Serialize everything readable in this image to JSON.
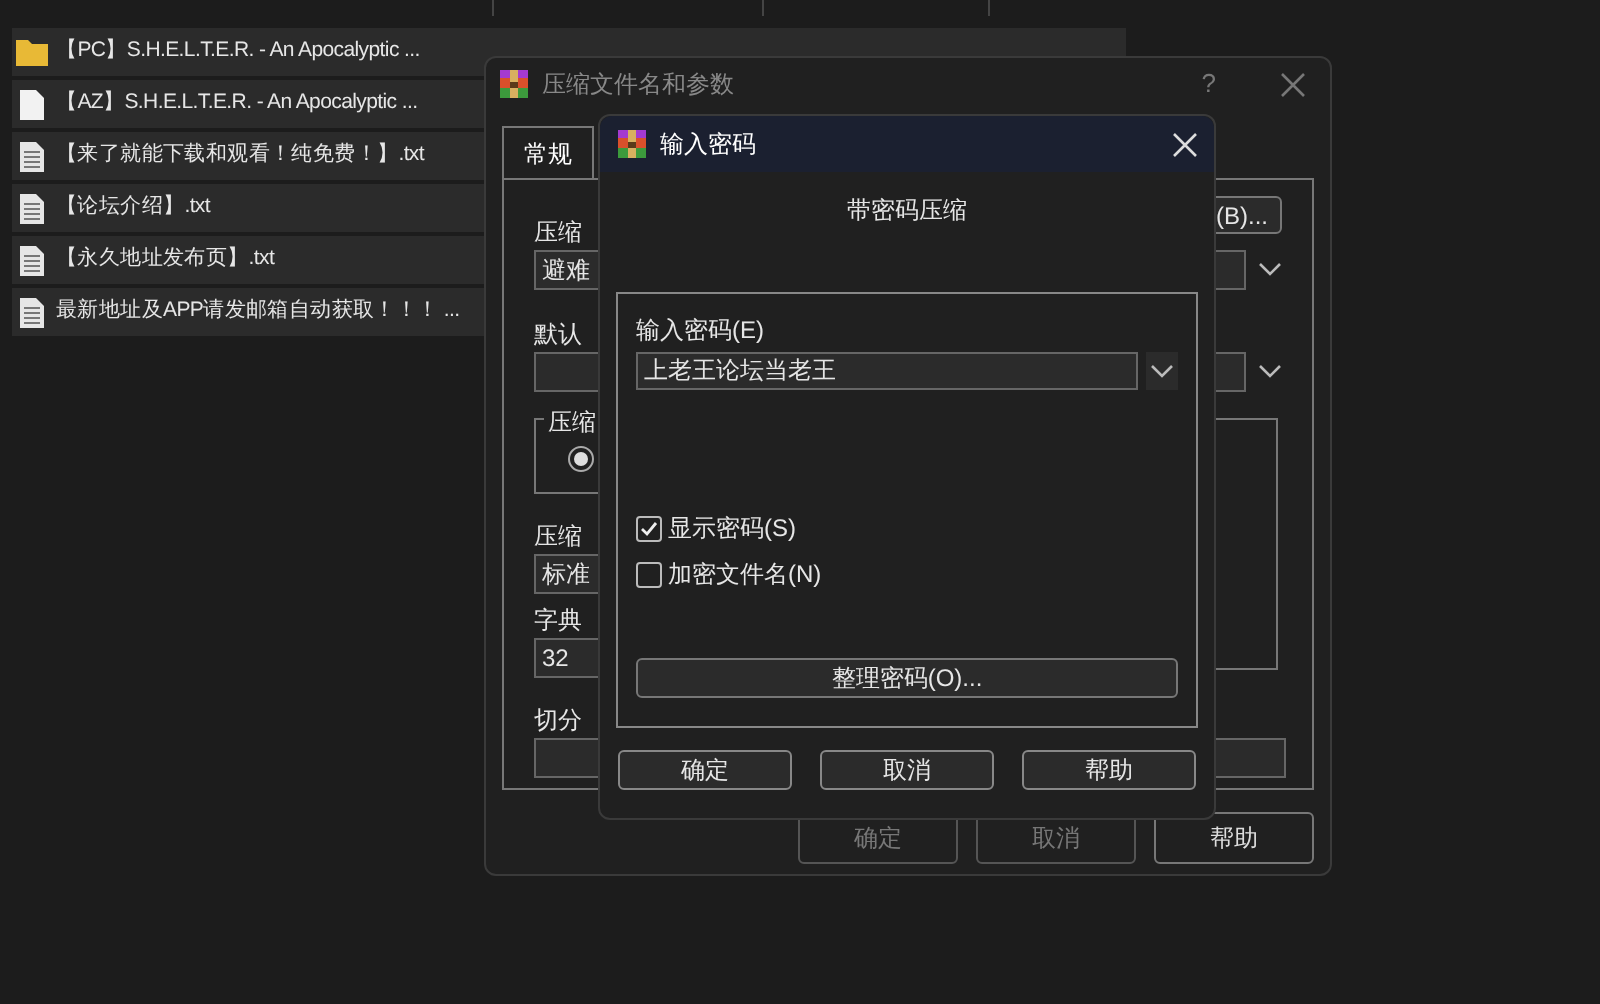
{
  "file_list": {
    "rows": [
      {
        "kind": "folder",
        "name": "【PC】S.H.E.L.T.E.R. - An Apocalyptic ..."
      },
      {
        "kind": "file",
        "name": "【AZ】S.H.E.L.T.E.R. - An Apocalyptic ..."
      },
      {
        "kind": "text",
        "name": "【来了就能下载和观看！纯免费！】.txt"
      },
      {
        "kind": "text",
        "name": "【论坛介绍】.txt"
      },
      {
        "kind": "text",
        "name": "【永久地址发布页】.txt"
      },
      {
        "kind": "text",
        "name": "最新地址及APP请发邮箱自动获取！！！ ..."
      }
    ]
  },
  "archive_dialog": {
    "title": "压缩文件名和参数",
    "help": "?",
    "tabs": [
      {
        "label": "常规",
        "selected": true
      }
    ],
    "browse_button": "(B)...",
    "archive_name_label": "压缩",
    "archive_name_value": "避难",
    "profile_label": "默认",
    "format_group_label": "压缩",
    "format_radio": {
      "selected": true
    },
    "method_label": "压缩",
    "method_value": "标准",
    "dictionary_label": "字典",
    "dictionary_value": "32",
    "split_label": "切分",
    "buttons": [
      {
        "label": "确定",
        "disabled": true
      },
      {
        "label": "取消",
        "disabled": true
      },
      {
        "label": "帮助",
        "disabled": false
      }
    ]
  },
  "password_dialog": {
    "title": "输入密码",
    "heading": "带密码压缩",
    "password_label": "输入密码(E)",
    "password_value": "上老王论坛当老王",
    "checkboxes": [
      {
        "label": "显示密码(S)",
        "checked": true
      },
      {
        "label": "加密文件名(N)",
        "checked": false
      }
    ],
    "organize_button": "整理密码(O)...",
    "buttons": [
      {
        "label": "确定"
      },
      {
        "label": "取消"
      },
      {
        "label": "帮助"
      }
    ]
  }
}
